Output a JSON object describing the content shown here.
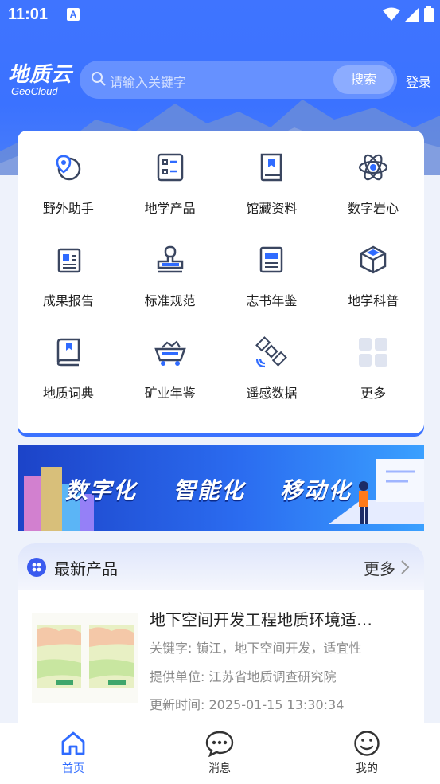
{
  "status": {
    "time": "11:01",
    "notification_icon_text": "A"
  },
  "header": {
    "logo_cn": "地质云",
    "logo_en": "GeoCloud",
    "search_placeholder": "请输入关键字",
    "search_button": "搜索",
    "login": "登录"
  },
  "grid": [
    {
      "label": "野外助手",
      "icon": "map-pin-globe-icon"
    },
    {
      "label": "地学产品",
      "icon": "list-document-icon"
    },
    {
      "label": "馆藏资料",
      "icon": "archive-book-icon"
    },
    {
      "label": "数字岩心",
      "icon": "atom-icon"
    },
    {
      "label": "成果报告",
      "icon": "report-document-icon"
    },
    {
      "label": "标准规范",
      "icon": "stamp-icon"
    },
    {
      "label": "志书年鉴",
      "icon": "yearbook-icon"
    },
    {
      "label": "地学科普",
      "icon": "cube-icon"
    },
    {
      "label": "地质词典",
      "icon": "dictionary-icon"
    },
    {
      "label": "矿业年鉴",
      "icon": "mine-cart-icon"
    },
    {
      "label": "遥感数据",
      "icon": "satellite-icon"
    },
    {
      "label": "更多",
      "icon": "more-grid-icon"
    }
  ],
  "banner": {
    "text1": "数字化",
    "text2": "智能化",
    "text3": "移动化"
  },
  "latest": {
    "title": "最新产品",
    "more": "更多",
    "item": {
      "title": "地下空间开发工程地质环境适…",
      "keywords": "关键字: 镇江，地下空间开发，适宜性",
      "provider": "提供单位: 江苏省地质调查研究院",
      "updated": "更新时间: 2025-01-15 13:30:34"
    }
  },
  "tabs": [
    {
      "label": "首页",
      "icon": "home-icon",
      "active": true
    },
    {
      "label": "消息",
      "icon": "message-icon",
      "active": false
    },
    {
      "label": "我的",
      "icon": "smile-profile-icon",
      "active": false
    }
  ],
  "colors": {
    "primary": "#3b72ff",
    "active_tab": "#2f6bff",
    "icon_dark": "#3a4660"
  }
}
